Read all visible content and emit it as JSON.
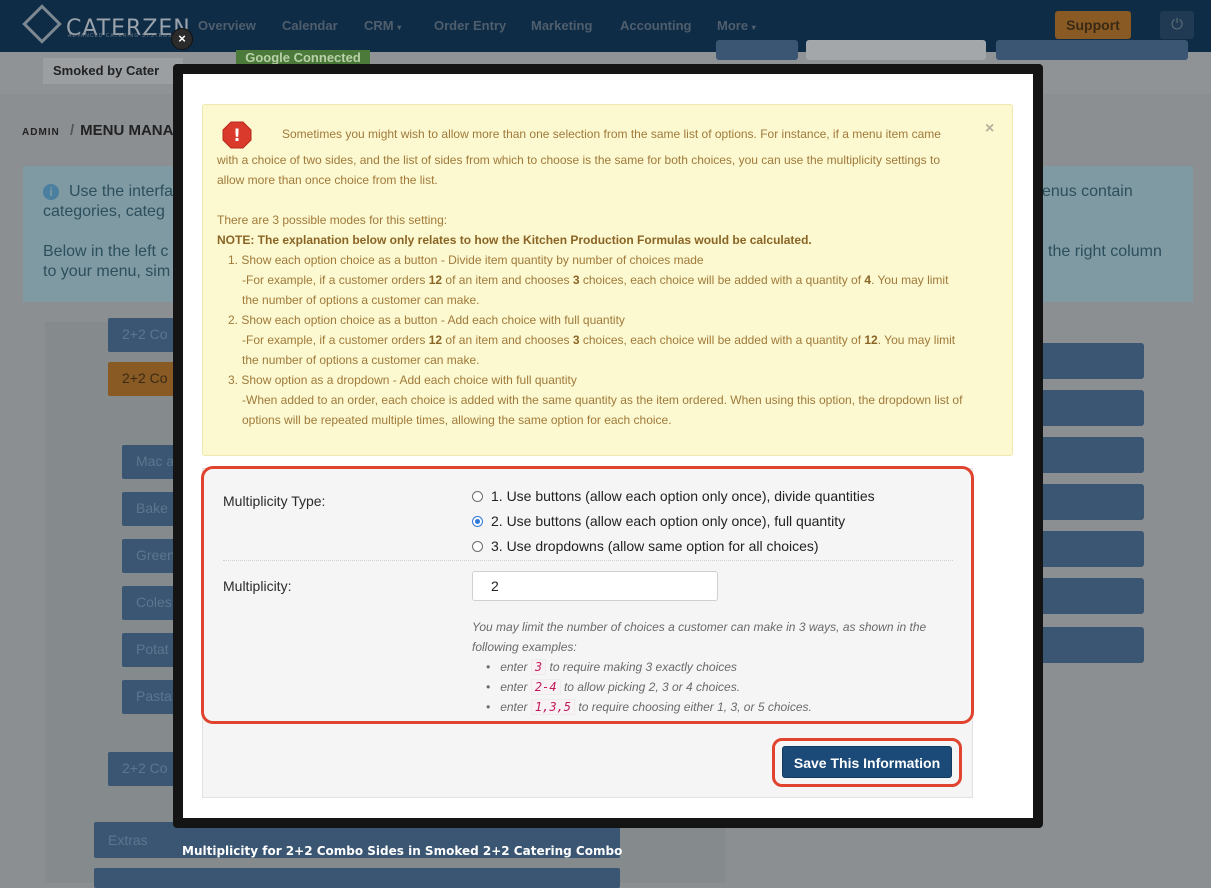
{
  "app": {
    "logo": "CATERZEN",
    "logo_sub": "ADVANCED CATERING SYSTEMS",
    "nav": [
      "Overview",
      "Calendar",
      "CRM",
      "Order Entry",
      "Marketing",
      "Accounting",
      "More"
    ],
    "support": "Support",
    "google_status": "Google Connected",
    "location": "Smoked by Cater",
    "breadcrumb_root": "ADMIN",
    "breadcrumb_sep": "/",
    "breadcrumb_page": "MENU MANA",
    "info_line1": "Use the interfa",
    "info_line1_right": "enus contain",
    "info_line2": "categories, categ",
    "info_line3": "Below in the left c",
    "info_line3_right": "the right column",
    "info_line4": "to your menu, sim",
    "menu_items": [
      "2+2 Co",
      "2+2 Co",
      "Mac a",
      "Bake",
      "Green",
      "Coles",
      "Potat",
      "Pasta",
      "2+2 Co",
      "Extras"
    ]
  },
  "modal": {
    "close": "×",
    "warning": {
      "icon": "!",
      "close": "×",
      "intro_1": "Sometimes you might wish to allow more than one selection from the same list of options. For instance, if a menu item came",
      "intro_2": "with a choice of two sides, and the list of sides from which to choose is the same for both choices, you can use the multiplicity settings to",
      "intro_3": "allow more than once choice from the list.",
      "modes_heading": "There are 3 possible modes for this setting:",
      "note": "NOTE: The explanation below only relates to how the Kitchen Production Formulas would be calculated.",
      "mode1_title": "1. Show each option choice as a button - Divide item quantity by number of choices made",
      "mode1_a": "-For example, if a customer orders ",
      "mode1_q1": "12",
      "mode1_b": " of an item and chooses ",
      "mode1_q2": "3",
      "mode1_c": " choices, each choice will be added with a quantity of ",
      "mode1_q3": "4",
      "mode1_d": ". You may limit",
      "mode1_e": "the number of options a customer can make.",
      "mode2_title": "2. Show each option choice as a button - Add each choice with full quantity",
      "mode2_a": "-For example, if a customer orders ",
      "mode2_q1": "12",
      "mode2_b": " of an item and chooses ",
      "mode2_q2": "3",
      "mode2_c": " choices, each choice will be added with a quantity of ",
      "mode2_q3": "12",
      "mode2_d": ". You may limit",
      "mode2_e": "the number of options a customer can make.",
      "mode3_title": "3. Show option as a dropdown - Add each choice with full quantity",
      "mode3_a": "-When added to an order, each choice is added with the same quantity as the item ordered. When using this option, the dropdown list of",
      "mode3_b": "options will be repeated multiple times, allowing the same option for each choice."
    },
    "form": {
      "type_label": "Multiplicity Type:",
      "options": [
        {
          "label": "1. Use buttons (allow each option only once), divide quantities",
          "checked": false
        },
        {
          "label": "2. Use buttons (allow each option only once), full quantity",
          "checked": true
        },
        {
          "label": "3. Use dropdowns (allow same option for all choices)",
          "checked": false
        }
      ],
      "multiplicity_label": "Multiplicity:",
      "multiplicity_value": "2",
      "help_1": "You may limit the number of choices a customer can make in 3 ways, as shown in the",
      "help_2": "following examples:",
      "examples": [
        {
          "pre": "enter",
          "code": "3",
          "post": "to require making 3 exactly choices"
        },
        {
          "pre": "enter",
          "code": "2-4",
          "post": "to allow picking 2, 3 or 4 choices."
        },
        {
          "pre": "enter",
          "code": "1,3,5",
          "post": "to require choosing either 1, 3, or 5 choices."
        }
      ],
      "save": "Save This Information"
    },
    "caption": "Multiplicity for 2+2 Combo Sides in Smoked 2+2 Catering Combo"
  }
}
